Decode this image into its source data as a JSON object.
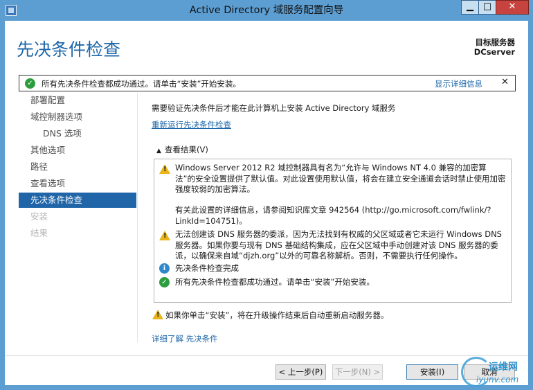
{
  "window": {
    "title": "Active Directory 域服务配置向导",
    "controls": {
      "minimize": "▁",
      "maximize": "□",
      "close": "✕"
    }
  },
  "header": {
    "page_title": "先决条件检查",
    "target_label": "目标服务器",
    "target_name": "DCserver"
  },
  "notification": {
    "text": "所有先决条件检查都成功通过。请单击“安装”开始安装。",
    "link": "显示详细信息",
    "close": "✕"
  },
  "nav": {
    "items": [
      {
        "label": "部署配置",
        "state": "normal"
      },
      {
        "label": "域控制器选项",
        "state": "normal"
      },
      {
        "label": "DNS 选项",
        "state": "normal"
      },
      {
        "label": "其他选项",
        "state": "normal"
      },
      {
        "label": "路径",
        "state": "normal"
      },
      {
        "label": "查看选项",
        "state": "normal"
      },
      {
        "label": "先决条件检查",
        "state": "active"
      },
      {
        "label": "安装",
        "state": "disabled"
      },
      {
        "label": "结果",
        "state": "disabled"
      }
    ]
  },
  "main": {
    "intro": "需要验证先决条件后才能在此计算机上安装 Active Directory 域服务",
    "rerun_link": "重新运行先决条件检查",
    "results_toggle": "查看结果(V)",
    "results": [
      {
        "icon": "warning-icon",
        "text": "Windows Server 2012 R2 域控制器具有名为“允许与 Windows NT 4.0 兼容的加密算法”的安全设置提供了默认值。对此设置使用默认值，将会在建立安全通道会话时禁止使用加密强度较弱的加密算法。"
      },
      {
        "icon": "none",
        "text": "有关此设置的详细信息，请参阅知识库文章 942564 (http://go.microsoft.com/fwlink/?LinkId=104751)。"
      },
      {
        "icon": "warning-icon",
        "text": "无法创建该 DNS 服务器的委派，因为无法找到有权威的父区域或者它未运行 Windows DNS 服务器。如果你要与现有 DNS 基础结构集成，应在父区域中手动创建对该 DNS 服务器的委派，以确保来自域“djzh.org”以外的可靠名称解析。否则，不需要执行任何操作。"
      },
      {
        "icon": "info-icon",
        "text": "先决条件检查完成"
      },
      {
        "icon": "success-icon",
        "text": "所有先决条件检查都成功通过。请单击“安装”开始安装。"
      }
    ],
    "footnote": "如果你单击“安装”，将在升级操作结束后自动重新启动服务器。",
    "more_link": "详细了解 先决条件"
  },
  "buttons": {
    "prev": "< 上一步(P)",
    "next": "下一步(N) >",
    "install": "安装(I)",
    "cancel": "取消"
  },
  "watermark": {
    "line1": "运维网",
    "line2": "iyunv.com"
  },
  "colors": {
    "accent": "#1f65a8",
    "titlebar": "#5d9ed2",
    "success": "#2d9e3f",
    "warning": "#e8b418",
    "info": "#2f88c9"
  }
}
